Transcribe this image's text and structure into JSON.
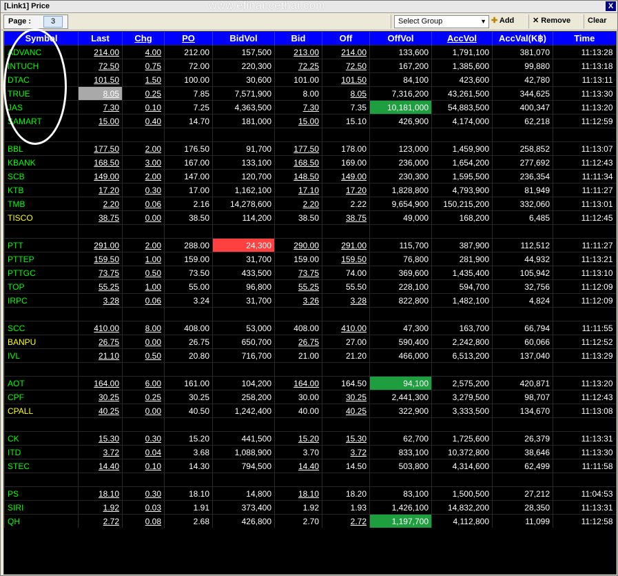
{
  "window": {
    "title": "[Link1] Price",
    "close": "X",
    "watermark": "www.efinancethai.com"
  },
  "toolbar": {
    "page_label": "Page :",
    "page_value": "3",
    "group_select": "Select Group",
    "add_label": "Add",
    "remove_label": "Remove",
    "clear_label": "Clear"
  },
  "columns": [
    "Symbol",
    "Last",
    "Chg",
    "PO",
    "BidVol",
    "Bid",
    "Off",
    "OffVol",
    "AccVol",
    "AccVal(K฿)",
    "Time"
  ],
  "colors": {
    "header_bg": "#0000ff",
    "grid_bg": "#000000",
    "up": "#00ff00",
    "unchanged": "#ffff00",
    "down": "#ff3030"
  },
  "groups": [
    {
      "rows": [
        {
          "symbol": "ADVANC",
          "last": "214.00",
          "chg": "4.00",
          "po": "212.00",
          "bidvol": "157,500",
          "bid": "213.00",
          "off": "214.00",
          "offvol": "133,600",
          "accvol": "1,791,100",
          "accval": "381,070",
          "time": "11:13:28"
        },
        {
          "symbol": "INTUCH",
          "last": "72.50",
          "chg": "0.75",
          "po": "72.00",
          "bidvol": "220,300",
          "bid": "72.25",
          "off": "72.50",
          "offvol": "167,200",
          "accvol": "1,385,600",
          "accval": "99,880",
          "time": "11:13:18"
        },
        {
          "symbol": "DTAC",
          "last": "101.50",
          "chg": "1.50",
          "po": "100.00",
          "bidvol": "30,600",
          "bid": "101.00",
          "off": "101.50",
          "offvol": "84,100",
          "accvol": "423,600",
          "accval": "42,780",
          "time": "11:13:11"
        },
        {
          "symbol": "TRUE",
          "last": "8.05",
          "chg": "0.25",
          "po": "7.85",
          "bidvol": "7,571,900",
          "bid": "8.00",
          "off": "8.05",
          "offvol": "7,316,200",
          "accvol": "43,261,500",
          "accval": "344,625",
          "time": "11:13:30"
        },
        {
          "symbol": "JAS",
          "last": "7.30",
          "chg": "0.10",
          "po": "7.25",
          "bidvol": "4,363,500",
          "bid": "7.30",
          "off": "7.35",
          "offvol": "10,181,000",
          "accvol": "54,883,500",
          "accval": "400,347",
          "time": "11:13:20"
        },
        {
          "symbol": "SAMART",
          "last": "15.00",
          "chg": "0.40",
          "po": "14.70",
          "bidvol": "181,000",
          "bid": "15.00",
          "off": "15.10",
          "offvol": "426,900",
          "accvol": "4,174,000",
          "accval": "62,218",
          "time": "11:12:59"
        }
      ]
    },
    {
      "rows": [
        {
          "symbol": "BBL",
          "last": "177.50",
          "chg": "2.00",
          "po": "176.50",
          "bidvol": "91,700",
          "bid": "177.50",
          "off": "178.00",
          "offvol": "123,000",
          "accvol": "1,459,900",
          "accval": "258,852",
          "time": "11:13:07"
        },
        {
          "symbol": "KBANK",
          "last": "168.50",
          "chg": "3.00",
          "po": "167.00",
          "bidvol": "133,100",
          "bid": "168.50",
          "off": "169.00",
          "offvol": "236,000",
          "accvol": "1,654,200",
          "accval": "277,692",
          "time": "11:12:43"
        },
        {
          "symbol": "SCB",
          "last": "149.00",
          "chg": "2.00",
          "po": "147.00",
          "bidvol": "120,700",
          "bid": "148.50",
          "off": "149.00",
          "offvol": "230,300",
          "accvol": "1,595,500",
          "accval": "236,354",
          "time": "11:11:34"
        },
        {
          "symbol": "KTB",
          "last": "17.20",
          "chg": "0.30",
          "po": "17.00",
          "bidvol": "1,162,100",
          "bid": "17.10",
          "off": "17.20",
          "offvol": "1,828,800",
          "accvol": "4,793,900",
          "accval": "81,949",
          "time": "11:11:27"
        },
        {
          "symbol": "TMB",
          "last": "2.20",
          "chg": "0.06",
          "po": "2.16",
          "bidvol": "14,278,600",
          "bid": "2.20",
          "off": "2.22",
          "offvol": "9,654,900",
          "accvol": "150,215,200",
          "accval": "332,060",
          "time": "11:13:01"
        },
        {
          "symbol": "TISCO",
          "last": "38.75",
          "chg": "0.00",
          "po": "38.50",
          "bidvol": "114,200",
          "bid": "38.50",
          "off": "38.75",
          "offvol": "49,000",
          "accvol": "168,200",
          "accval": "6,485",
          "time": "11:12:45"
        }
      ]
    },
    {
      "rows": [
        {
          "symbol": "PTT",
          "last": "291.00",
          "chg": "2.00",
          "po": "288.00",
          "bidvol": "24,300",
          "bid": "290.00",
          "off": "291.00",
          "offvol": "115,700",
          "accvol": "387,900",
          "accval": "112,512",
          "time": "11:11:27"
        },
        {
          "symbol": "PTTEP",
          "last": "159.50",
          "chg": "1.00",
          "po": "159.00",
          "bidvol": "31,700",
          "bid": "159.00",
          "off": "159.50",
          "offvol": "76,800",
          "accvol": "281,900",
          "accval": "44,932",
          "time": "11:13:21"
        },
        {
          "symbol": "PTTGC",
          "last": "73.75",
          "chg": "0.50",
          "po": "73.50",
          "bidvol": "433,500",
          "bid": "73.75",
          "off": "74.00",
          "offvol": "369,600",
          "accvol": "1,435,400",
          "accval": "105,942",
          "time": "11:13:10"
        },
        {
          "symbol": "TOP",
          "last": "55.25",
          "chg": "1.00",
          "po": "55.00",
          "bidvol": "96,800",
          "bid": "55.25",
          "off": "55.50",
          "offvol": "228,100",
          "accvol": "594,700",
          "accval": "32,756",
          "time": "11:12:09"
        },
        {
          "symbol": "IRPC",
          "last": "3.28",
          "chg": "0.06",
          "po": "3.24",
          "bidvol": "31,700",
          "bid": "3.26",
          "off": "3.28",
          "offvol": "822,800",
          "accvol": "1,482,100",
          "accval": "4,824",
          "time": "11:12:09"
        }
      ]
    },
    {
      "rows": [
        {
          "symbol": "SCC",
          "last": "410.00",
          "chg": "8.00",
          "po": "408.00",
          "bidvol": "53,000",
          "bid": "408.00",
          "off": "410.00",
          "offvol": "47,300",
          "accvol": "163,700",
          "accval": "66,794",
          "time": "11:11:55"
        },
        {
          "symbol": "BANPU",
          "last": "26.75",
          "chg": "0.00",
          "po": "26.75",
          "bidvol": "650,700",
          "bid": "26.75",
          "off": "27.00",
          "offvol": "590,400",
          "accvol": "2,242,800",
          "accval": "60,066",
          "time": "11:12:52"
        },
        {
          "symbol": "IVL",
          "last": "21.10",
          "chg": "0.50",
          "po": "20.80",
          "bidvol": "716,700",
          "bid": "21.00",
          "off": "21.20",
          "offvol": "466,000",
          "accvol": "6,513,200",
          "accval": "137,040",
          "time": "11:13:29"
        }
      ]
    },
    {
      "rows": [
        {
          "symbol": "AOT",
          "last": "164.00",
          "chg": "6.00",
          "po": "161.00",
          "bidvol": "104,200",
          "bid": "164.00",
          "off": "164.50",
          "offvol": "94,100",
          "accvol": "2,575,200",
          "accval": "420,871",
          "time": "11:13:20"
        },
        {
          "symbol": "CPF",
          "last": "30.25",
          "chg": "0.25",
          "po": "30.25",
          "bidvol": "258,200",
          "bid": "30.00",
          "off": "30.25",
          "offvol": "2,441,300",
          "accvol": "3,279,500",
          "accval": "98,707",
          "time": "11:12:43"
        },
        {
          "symbol": "CPALL",
          "last": "40.25",
          "chg": "0.00",
          "po": "40.50",
          "bidvol": "1,242,400",
          "bid": "40.00",
          "off": "40.25",
          "offvol": "322,900",
          "accvol": "3,333,500",
          "accval": "134,670",
          "time": "11:13:08"
        }
      ]
    },
    {
      "rows": [
        {
          "symbol": "CK",
          "last": "15.30",
          "chg": "0.30",
          "po": "15.20",
          "bidvol": "441,500",
          "bid": "15.20",
          "off": "15.30",
          "offvol": "62,700",
          "accvol": "1,725,600",
          "accval": "26,379",
          "time": "11:13:31"
        },
        {
          "symbol": "ITD",
          "last": "3.72",
          "chg": "0.04",
          "po": "3.68",
          "bidvol": "1,088,900",
          "bid": "3.70",
          "off": "3.72",
          "offvol": "833,100",
          "accvol": "10,372,800",
          "accval": "38,646",
          "time": "11:13:30"
        },
        {
          "symbol": "STEC",
          "last": "14.40",
          "chg": "0.10",
          "po": "14.30",
          "bidvol": "794,500",
          "bid": "14.40",
          "off": "14.50",
          "offvol": "503,800",
          "accvol": "4,314,600",
          "accval": "62,499",
          "time": "11:11:58"
        }
      ]
    },
    {
      "rows": [
        {
          "symbol": "PS",
          "last": "18.10",
          "chg": "0.30",
          "po": "18.10",
          "bidvol": "14,800",
          "bid": "18.10",
          "off": "18.20",
          "offvol": "83,100",
          "accvol": "1,500,500",
          "accval": "27,212",
          "time": "11:04:53"
        },
        {
          "symbol": "SIRI",
          "last": "1.92",
          "chg": "0.03",
          "po": "1.91",
          "bidvol": "373,400",
          "bid": "1.92",
          "off": "1.93",
          "offvol": "1,426,100",
          "accvol": "14,832,200",
          "accval": "28,350",
          "time": "11:13:31"
        },
        {
          "symbol": "QH",
          "last": "2.72",
          "chg": "0.08",
          "po": "2.68",
          "bidvol": "426,800",
          "bid": "2.70",
          "off": "2.72",
          "offvol": "1,197,700",
          "accvol": "4,112,800",
          "accval": "11,099",
          "time": "11:12:58"
        }
      ]
    }
  ]
}
